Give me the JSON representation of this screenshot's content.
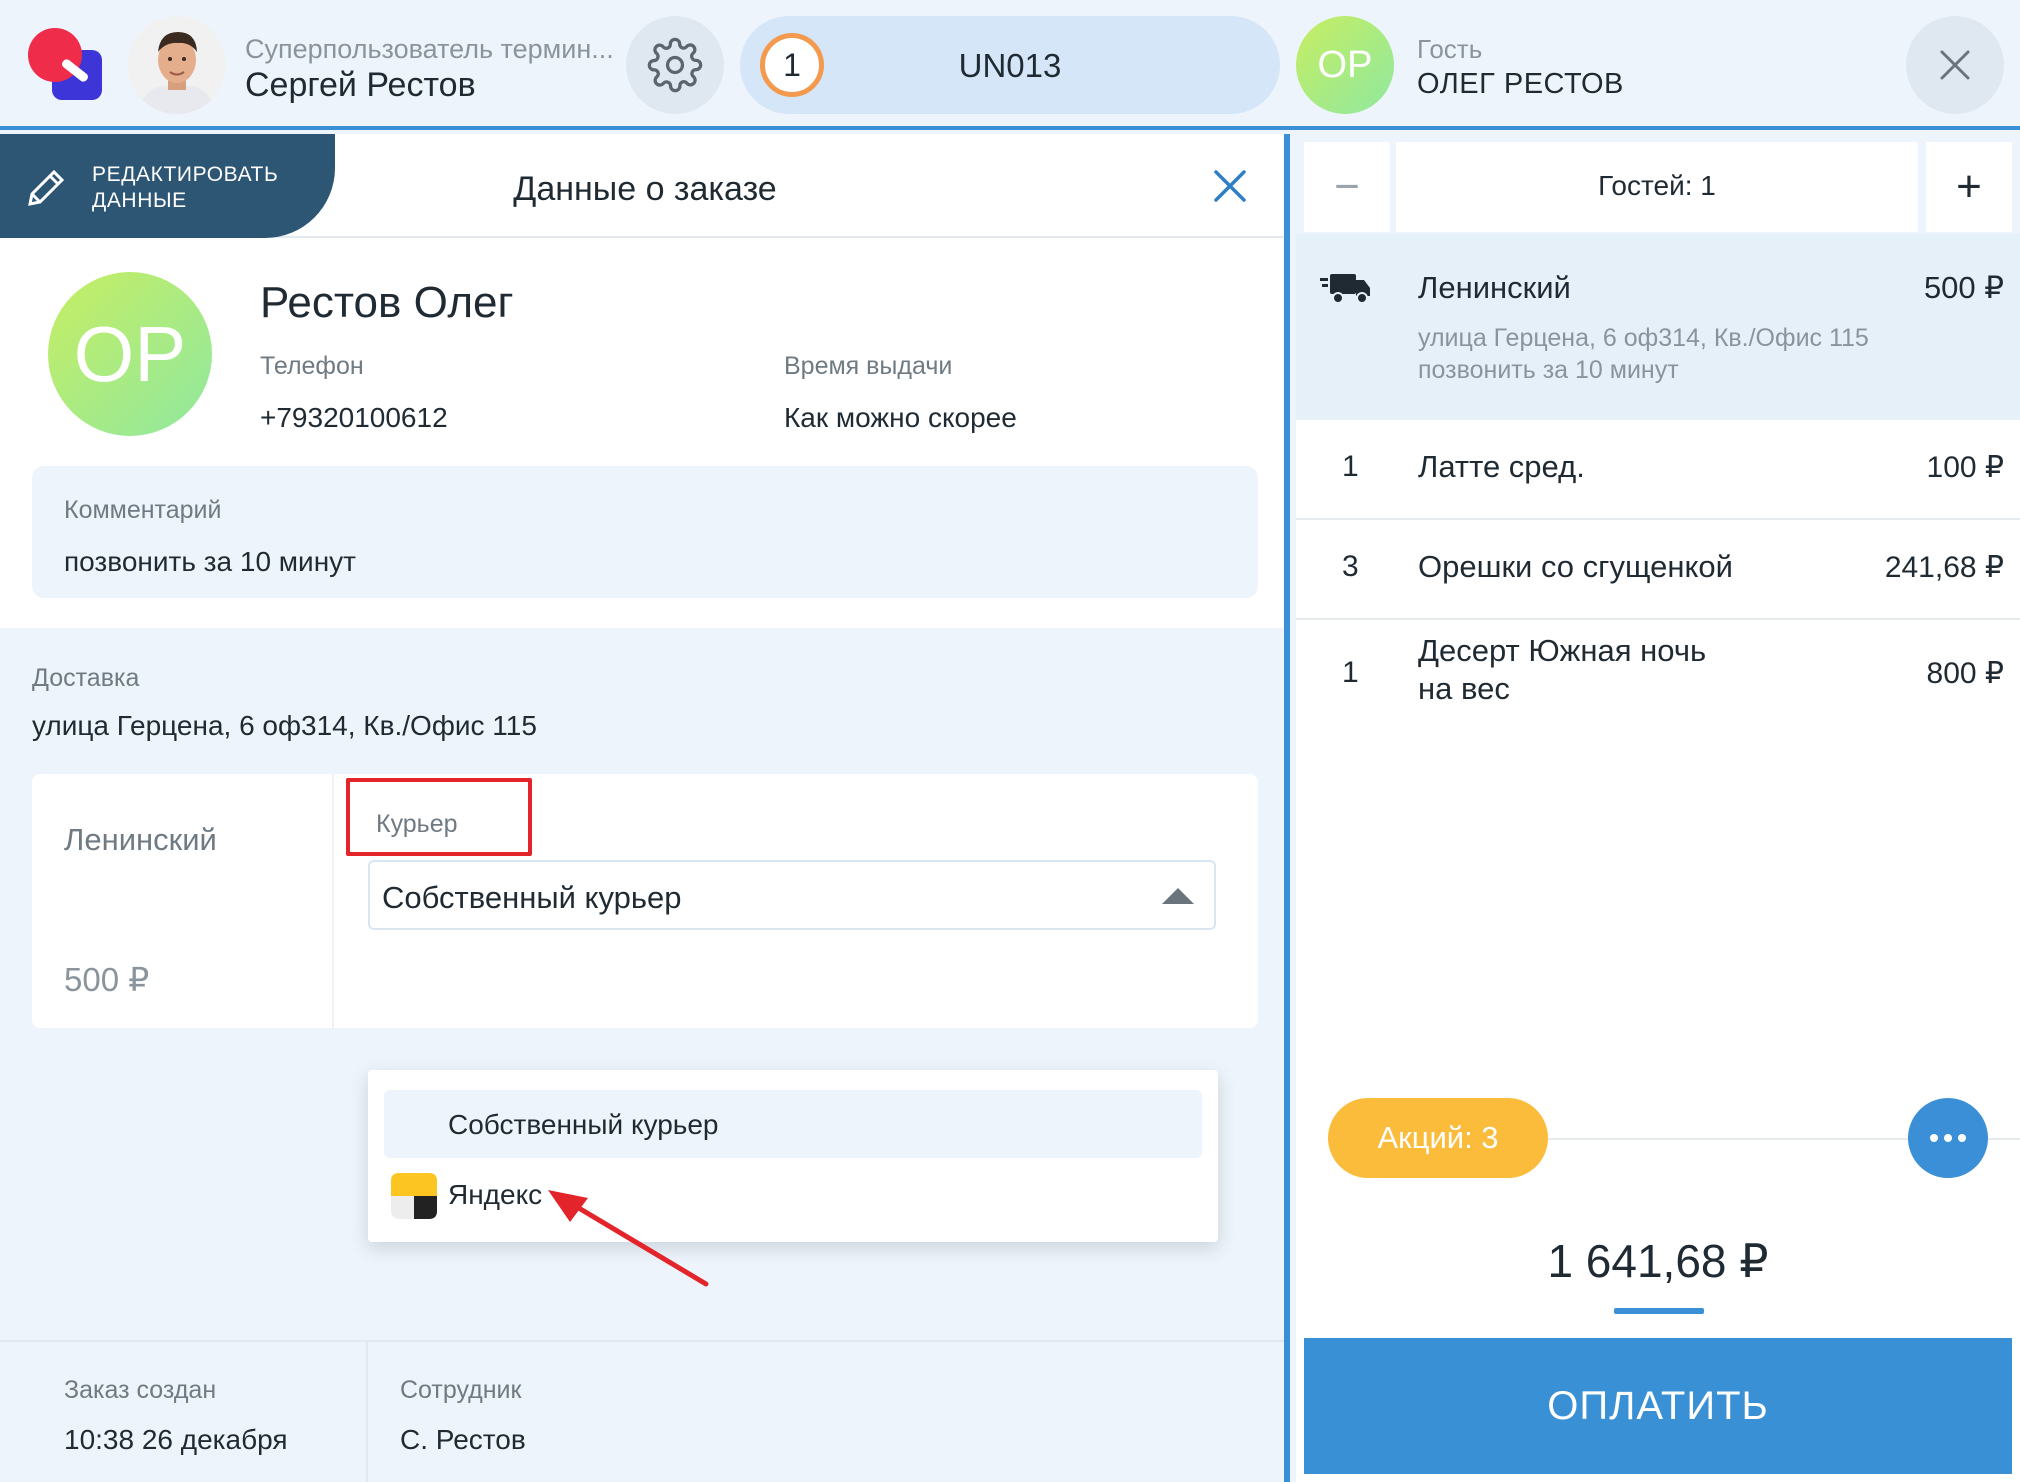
{
  "topbar": {
    "user_role": "Суперпользователь термин...",
    "user_name": "Сергей Рестов",
    "order_number": "1",
    "order_code": "UN013",
    "guest_initials": "OP",
    "guest_label": "Гость",
    "guest_name": "ОЛЕГ РЕСТОВ"
  },
  "left": {
    "edit_tab_line1": "РЕДАКТИРОВАТЬ",
    "edit_tab_line2": "ДАННЫЕ",
    "title": "Данные о заказе",
    "customer": {
      "initials": "OP",
      "name": "Рестов Олег",
      "phone_label": "Телефон",
      "phone": "+79320100612",
      "time_label": "Время выдачи",
      "time": "Как можно скорее"
    },
    "comment": {
      "label": "Комментарий",
      "value": "позвонить за 10 минут"
    },
    "delivery": {
      "label": "Доставка",
      "address": "улица Герцена, 6 оф314, Кв./Офис 115",
      "zone_name": "Ленинский",
      "zone_price": "500 ₽",
      "courier_label": "Курьер",
      "courier_selected": "Собственный курьер",
      "courier_options": [
        "Собственный курьер",
        "Яндекс"
      ]
    },
    "footer": {
      "created_label": "Заказ создан",
      "created_value": "10:38 26 декабря",
      "staff_label": "Сотрудник",
      "staff_value": "С. Рестов"
    }
  },
  "right": {
    "guests": {
      "minus": "−",
      "plus": "+",
      "count_text": "Гостей: 1"
    },
    "delivery_row": {
      "name": "Ленинский",
      "price": "500 ₽",
      "address": "улица Герцена, 6 оф314, Кв./Офис 115",
      "comment": "позвонить за 10 минут"
    },
    "items": [
      {
        "qty": "1",
        "name": "Латте сред.",
        "price": "100 ₽"
      },
      {
        "qty": "3",
        "name": "Орешки со сгущенкой",
        "price": "241,68 ₽"
      },
      {
        "qty": "1",
        "name": "Десерт Южная ночь на вес",
        "price": "800 ₽"
      }
    ],
    "promo": "Акций: 3",
    "total": "1 641,68 ₽",
    "pay": "ОПЛАТИТЬ"
  },
  "colors": {
    "accent": "#3a8fd6",
    "edit_tab": "#2d5574",
    "promo": "#fbbb3b",
    "highlight": "#e3252b"
  },
  "icons": [
    "app-logo",
    "gear-icon",
    "close-icon",
    "pencil-icon",
    "caret-up-icon",
    "yandex-icon",
    "truck-icon",
    "more-icon"
  ]
}
